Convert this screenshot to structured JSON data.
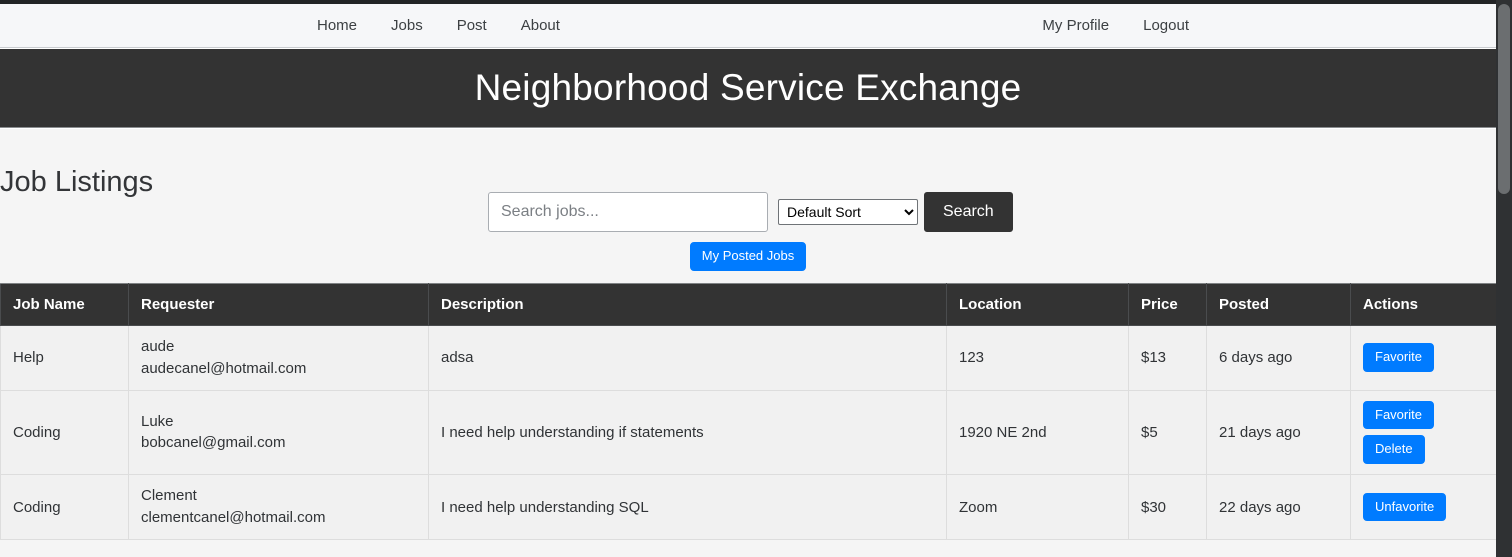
{
  "navbar": {
    "left_links": [
      {
        "label": "Home",
        "name": "nav-link-home"
      },
      {
        "label": "Jobs",
        "name": "nav-link-jobs"
      },
      {
        "label": "Post",
        "name": "nav-link-post"
      },
      {
        "label": "About",
        "name": "nav-link-about"
      }
    ],
    "right_links": [
      {
        "label": "My Profile",
        "name": "nav-link-my-profile"
      },
      {
        "label": "Logout",
        "name": "nav-link-logout"
      }
    ]
  },
  "banner": {
    "title": "Neighborhood Service Exchange"
  },
  "page": {
    "title": "Job Listings"
  },
  "search": {
    "placeholder": "Search jobs...",
    "value": "",
    "sort_selected": "Default Sort",
    "sort_options": [
      "Default Sort"
    ],
    "search_button_label": "Search",
    "my_posted_jobs_label": "My Posted Jobs"
  },
  "table": {
    "columns": [
      "Job Name",
      "Requester",
      "Description",
      "Location",
      "Price",
      "Posted",
      "Actions"
    ],
    "rows": [
      {
        "job_name": "Help",
        "requester_name": "aude",
        "requester_email": "audecanel@hotmail.com",
        "description": "adsa",
        "location": "123",
        "price": "$13",
        "posted": "6 days ago",
        "actions": [
          {
            "label": "Favorite",
            "name": "favorite-button"
          }
        ]
      },
      {
        "job_name": "Coding",
        "requester_name": "Luke",
        "requester_email": "bobcanel@gmail.com",
        "description": "I need help understanding if statements",
        "location": "1920 NE 2nd",
        "price": "$5",
        "posted": "21 days ago",
        "actions": [
          {
            "label": "Favorite",
            "name": "favorite-button"
          },
          {
            "label": "Delete",
            "name": "delete-button"
          }
        ]
      },
      {
        "job_name": "Coding",
        "requester_name": "Clement",
        "requester_email": "clementcanel@hotmail.com",
        "description": "I need help understanding SQL",
        "location": "Zoom",
        "price": "$30",
        "posted": "22 days ago",
        "actions": [
          {
            "label": "Unfavorite",
            "name": "unfavorite-button"
          }
        ]
      }
    ]
  },
  "colors": {
    "banner_bg": "#333333",
    "navbar_bg": "#f6f7f9",
    "primary_blue": "#007bff",
    "page_bg": "#f5f5f5",
    "table_row_bg": "#f1f1f1"
  }
}
